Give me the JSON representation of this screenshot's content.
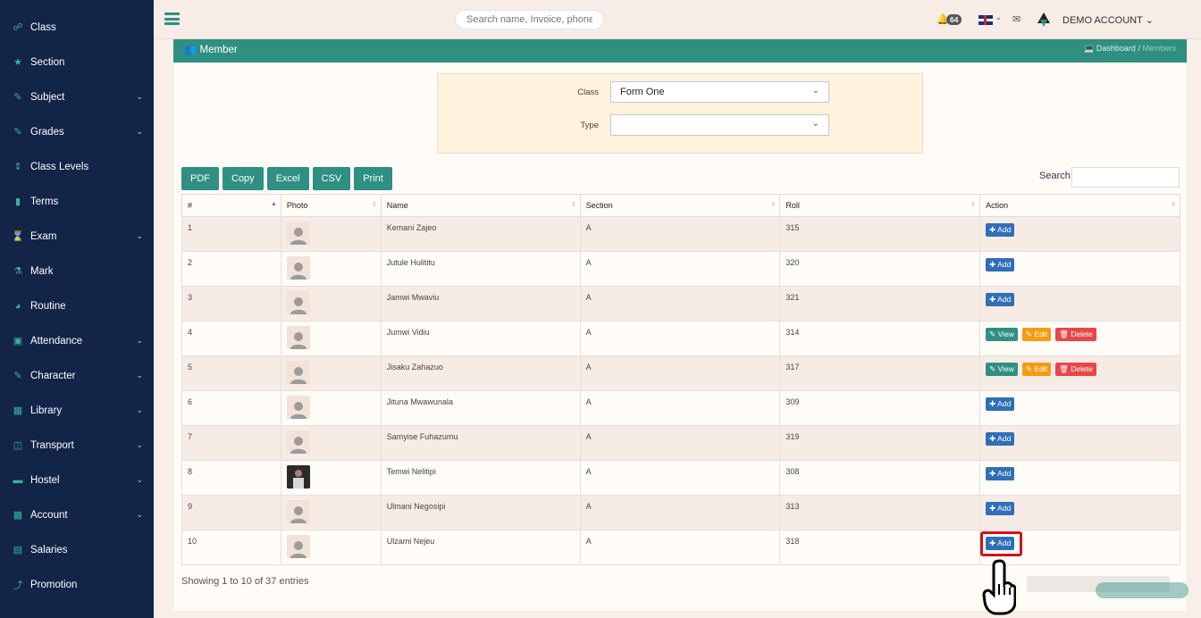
{
  "sidebar": {
    "items": [
      {
        "label": "Class",
        "icon": "sitemap-icon",
        "chev": false
      },
      {
        "label": "Section",
        "icon": "star-icon",
        "chev": false
      },
      {
        "label": "Subject",
        "icon": "edit-icon",
        "chev": true
      },
      {
        "label": "Grades",
        "icon": "edit-icon",
        "chev": true
      },
      {
        "label": "Class Levels",
        "icon": "sort-icon",
        "chev": false
      },
      {
        "label": "Terms",
        "icon": "signal-icon",
        "chev": false
      },
      {
        "label": "Exam",
        "icon": "hourglass-icon",
        "chev": true
      },
      {
        "label": "Mark",
        "icon": "flask-icon",
        "chev": false
      },
      {
        "label": "Routine",
        "icon": "clock-icon",
        "chev": false
      },
      {
        "label": "Attendance",
        "icon": "clipboard-icon",
        "chev": true
      },
      {
        "label": "Character",
        "icon": "edit-icon",
        "chev": true
      },
      {
        "label": "Library",
        "icon": "books-icon",
        "chev": true
      },
      {
        "label": "Transport",
        "icon": "bus-icon",
        "chev": true
      },
      {
        "label": "Hostel",
        "icon": "bed-icon",
        "chev": true
      },
      {
        "label": "Account",
        "icon": "money-icon",
        "chev": true
      },
      {
        "label": "Salaries",
        "icon": "salary-icon",
        "chev": false
      },
      {
        "label": "Promotion",
        "icon": "promotion-icon",
        "chev": false
      }
    ]
  },
  "topbar": {
    "search_placeholder": "Search name, Invoice, phone, email",
    "notification_count": "64",
    "account_name": "DEMO ACCOUNT"
  },
  "panel": {
    "title": "Member",
    "breadcrumb": {
      "home": "Dashboard",
      "separator": "/",
      "current": "Members"
    }
  },
  "filters": {
    "class_label": "Class",
    "class_value": "Form One",
    "type_label": "Type",
    "type_value": ""
  },
  "toolbar": {
    "buttons": [
      "PDF",
      "Copy",
      "Excel",
      "CSV",
      "Print"
    ],
    "search_label": "Search:"
  },
  "table": {
    "headers": [
      "#",
      "Photo",
      "Name",
      "Section",
      "Roll",
      "Action"
    ],
    "rows": [
      {
        "num": "1",
        "name": "Kemani Zajeo",
        "section": "A",
        "roll": "315",
        "actions": [
          "add"
        ],
        "photo": "placeholder"
      },
      {
        "num": "2",
        "name": "Jutule Hulititu",
        "section": "A",
        "roll": "320",
        "actions": [
          "add"
        ],
        "photo": "placeholder"
      },
      {
        "num": "3",
        "name": "Jamwi Mwaviu",
        "section": "A",
        "roll": "321",
        "actions": [
          "add"
        ],
        "photo": "placeholder"
      },
      {
        "num": "4",
        "name": "Jumwi Vidiu",
        "section": "A",
        "roll": "314",
        "actions": [
          "view",
          "edit",
          "delete"
        ],
        "photo": "placeholder"
      },
      {
        "num": "5",
        "name": "Jisaku Zahazuo",
        "section": "A",
        "roll": "317",
        "actions": [
          "view",
          "edit",
          "delete"
        ],
        "photo": "placeholder"
      },
      {
        "num": "6",
        "name": "Jituna Mwawunala",
        "section": "A",
        "roll": "309",
        "actions": [
          "add"
        ],
        "photo": "placeholder"
      },
      {
        "num": "7",
        "name": "Samyise Fuhazumu",
        "section": "A",
        "roll": "319",
        "actions": [
          "add"
        ],
        "photo": "placeholder"
      },
      {
        "num": "8",
        "name": "Temwi Nelitipi",
        "section": "A",
        "roll": "308",
        "actions": [
          "add"
        ],
        "photo": "photo"
      },
      {
        "num": "9",
        "name": "Ulmani Negosipi",
        "section": "A",
        "roll": "313",
        "actions": [
          "add"
        ],
        "photo": "placeholder"
      },
      {
        "num": "10",
        "name": "Ulzami Nejeu",
        "section": "A",
        "roll": "318",
        "actions": [
          "add"
        ],
        "photo": "placeholder"
      }
    ],
    "action_labels": {
      "add": "Add",
      "view": "View",
      "edit": "Edit",
      "delete": "Delete"
    }
  },
  "footer": {
    "entries_info": "Showing 1 to 10 of 37 entries"
  },
  "colors": {
    "primary": "#2e8f82",
    "sidebar": "#122447",
    "add": "#2f6fb8",
    "edit": "#f39c12",
    "delete": "#e8474a",
    "highlight": "#d1121a"
  }
}
